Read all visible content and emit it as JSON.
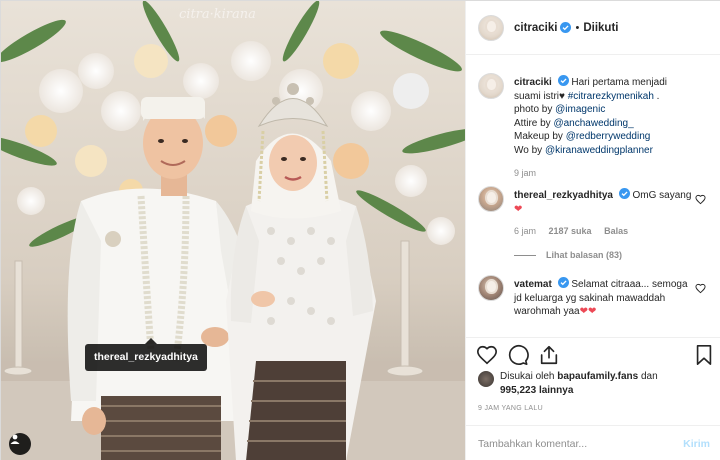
{
  "photo": {
    "watermark": "citra·kirana",
    "tag_label": "thereal_rezkyadhitya"
  },
  "header": {
    "username": "citraciki",
    "follow_status": "Diikuti"
  },
  "caption": {
    "username": "citraciki",
    "text_1": "Hari pertama menjadi suami istri",
    "heart": "♥",
    "hashtag": "#citrarezkymenikah",
    "text_2": ".",
    "photo_by": "photo by",
    "photo_handle": "@imagenic",
    "attire_by": "Attire by",
    "attire_handle": "@anchawedding_",
    "makeup_by": "Makeup by",
    "makeup_handle": "@redberrywedding",
    "wo_by": "Wo by",
    "wo_handle": "@kiranaweddingplanner",
    "time": "9 jam"
  },
  "comments": [
    {
      "username": "thereal_rezkyadhitya",
      "text": "OmG sayang",
      "emoji": "❤",
      "time": "6 jam",
      "likes": "2187 suka",
      "reply": "Balas",
      "view_replies": "Lihat balasan (83)"
    },
    {
      "username": "vatemat",
      "text": "Selamat citraaa... semoga jd keluarga yg sakinah mawaddah warohmah yaa",
      "emoji": "❤❤"
    }
  ],
  "likes": {
    "prefix": "Disukai oleh",
    "user": "bapaufamily.fans",
    "and": "dan",
    "count": "995,223",
    "suffix": "lainnya"
  },
  "timestamp": "9 JAM YANG LALU",
  "add_comment": {
    "placeholder": "Tambahkan komentar...",
    "post_label": "Kirim"
  },
  "colors": {
    "verified": "#3897f0",
    "link": "#00376b",
    "heart": "#ed4956",
    "post_disabled": "#b2dffc"
  },
  "icons": [
    "heart-icon",
    "comment-icon",
    "share-icon",
    "bookmark-icon",
    "user-tag-icon",
    "verified-icon"
  ]
}
